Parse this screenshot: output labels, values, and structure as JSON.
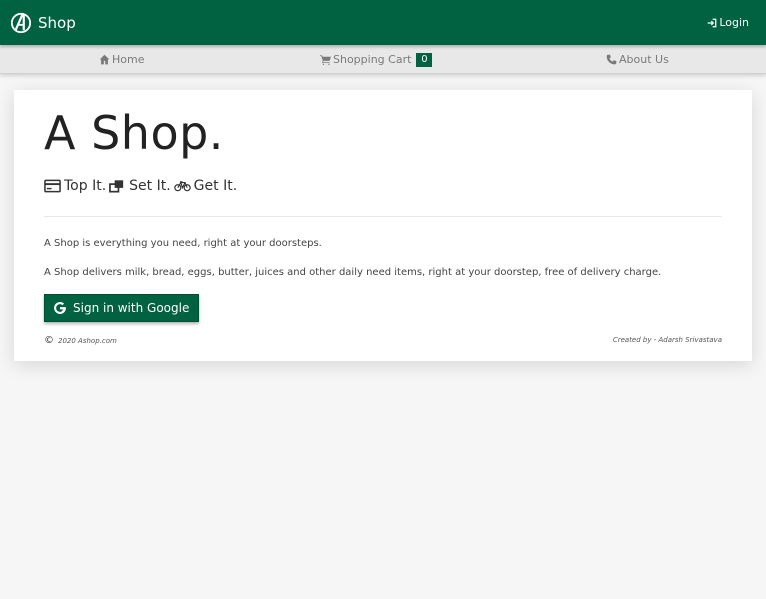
{
  "header": {
    "brand": "Shop",
    "login_label": "Login"
  },
  "nav": {
    "home": "Home",
    "cart": "Shopping Cart",
    "cart_count": "0",
    "about": "About Us"
  },
  "hero": {
    "title": "A Shop.",
    "tagline": [
      "Top It.",
      "Set It.",
      "Get It."
    ],
    "paragraph1": "A Shop is everything you need, right at your doorsteps.",
    "paragraph2": "A Shop delivers milk, bread, eggs, butter, juices and other daily need items, right at your doorstep, free of delivery charge.",
    "google_button": "Sign in with Google"
  },
  "footer": {
    "copyright_symbol": "©",
    "copyright": "2020 Ashop.com",
    "credit": "Created by - Adarsh Srivastava"
  },
  "colors": {
    "brand_green": "#006241",
    "nav_bg": "#e8e8e8",
    "page_bg": "#f6f6f6"
  }
}
